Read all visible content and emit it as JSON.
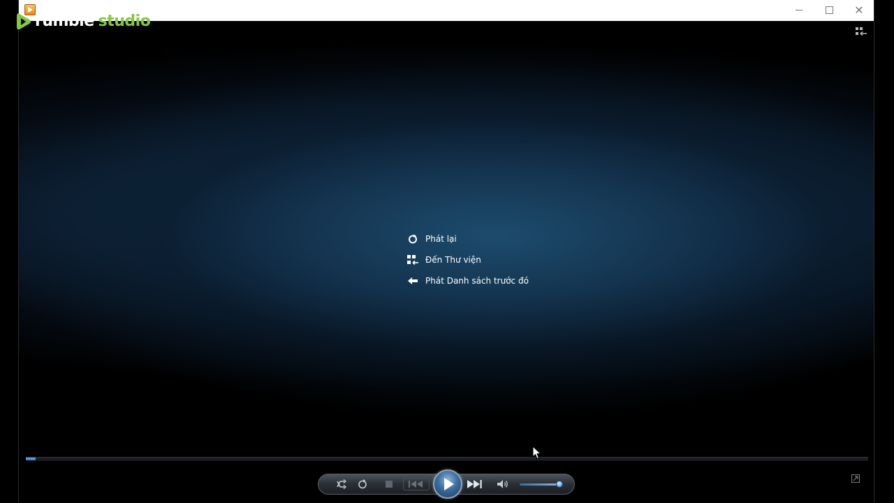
{
  "watermark": {
    "brand": "rumble",
    "product": "studio",
    "brand_color": "#85c742"
  },
  "window": {
    "title": "",
    "app_icon": "windows-media-player-icon",
    "buttons": {
      "minimize_icon": "minimize-icon",
      "maximize_icon": "maximize-icon",
      "close_icon": "close-icon",
      "close_glyph": "✕"
    }
  },
  "header": {
    "switch_to_library_icon": "switch-to-library-icon"
  },
  "end_menu": {
    "items": [
      {
        "label": "Phát lại",
        "icon": "replay-icon"
      },
      {
        "label": "Đến Thư viện",
        "icon": "library-icon"
      },
      {
        "label": "Phát Danh sách trước đó",
        "icon": "back-arrow-icon"
      }
    ]
  },
  "seek_bar": {
    "progress": 0.012,
    "fill_color": "#5b9bd5"
  },
  "controls": {
    "shuffle_icon": "shuffle-icon",
    "repeat_icon": "repeat-icon",
    "stop_icon": "stop-icon",
    "previous_icon": "previous-icon",
    "play_icon": "play-icon",
    "next_icon": "next-icon",
    "mute_icon": "speaker-icon",
    "volume": 0.92
  },
  "footer": {
    "switch_to_now_playing_icon": "expand-icon"
  },
  "colors": {
    "accent": "#3c6d9f",
    "background": "#000000",
    "video_glow": "#16324c"
  }
}
